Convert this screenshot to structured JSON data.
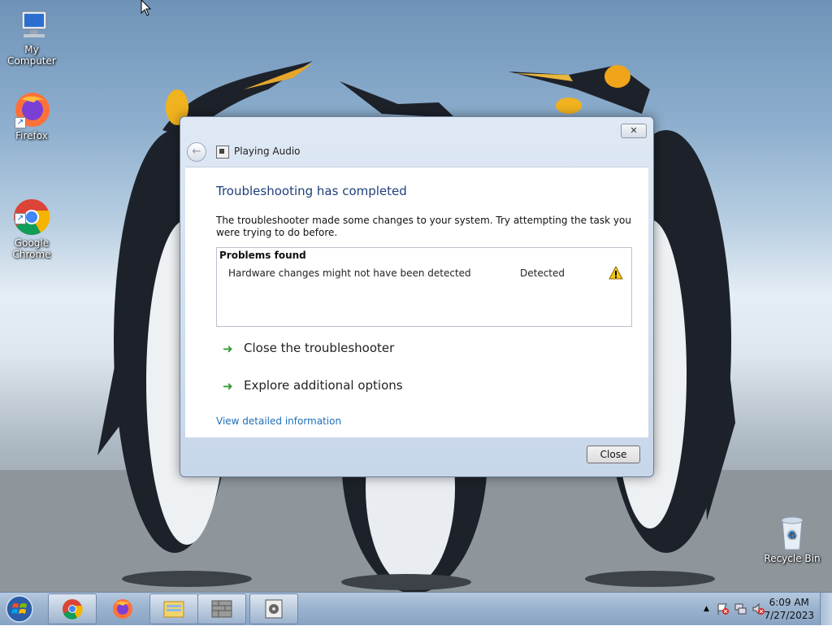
{
  "desktop": {
    "icons": [
      {
        "label": "My Computer",
        "icon": "computer-icon"
      },
      {
        "label": "Firefox",
        "icon": "firefox-icon"
      },
      {
        "label": "Google\nChrome",
        "icon": "chrome-icon"
      },
      {
        "label": "Recycle Bin",
        "icon": "recycle-bin-icon"
      }
    ]
  },
  "dialog": {
    "title": "Playing Audio",
    "heading": "Troubleshooting has completed",
    "description": "The troubleshooter made some changes to your system. Try attempting the task you were trying to do before.",
    "problems": {
      "header": "Problems found",
      "rows": [
        {
          "name": "Hardware changes might not have been detected",
          "status": "Detected",
          "icon": "warning-icon"
        }
      ]
    },
    "actions": [
      {
        "label": "Close the troubleshooter",
        "icon": "green-arrow-icon"
      },
      {
        "label": "Explore additional options",
        "icon": "green-arrow-icon"
      }
    ],
    "link": "View detailed information",
    "close_button": "Close",
    "close_glyph": "✕"
  },
  "taskbar": {
    "buttons": [
      {
        "name": "chrome",
        "icon": "chrome-icon"
      },
      {
        "name": "firefox",
        "icon": "firefox-icon"
      },
      {
        "name": "file-explorer",
        "icon": "folder-icon"
      },
      {
        "name": "firewall",
        "icon": "firewall-icon"
      },
      {
        "name": "troubleshooter",
        "icon": "troubleshooter-icon"
      }
    ],
    "tray": {
      "time": "6:09 AM",
      "date": "7/27/2023"
    }
  }
}
